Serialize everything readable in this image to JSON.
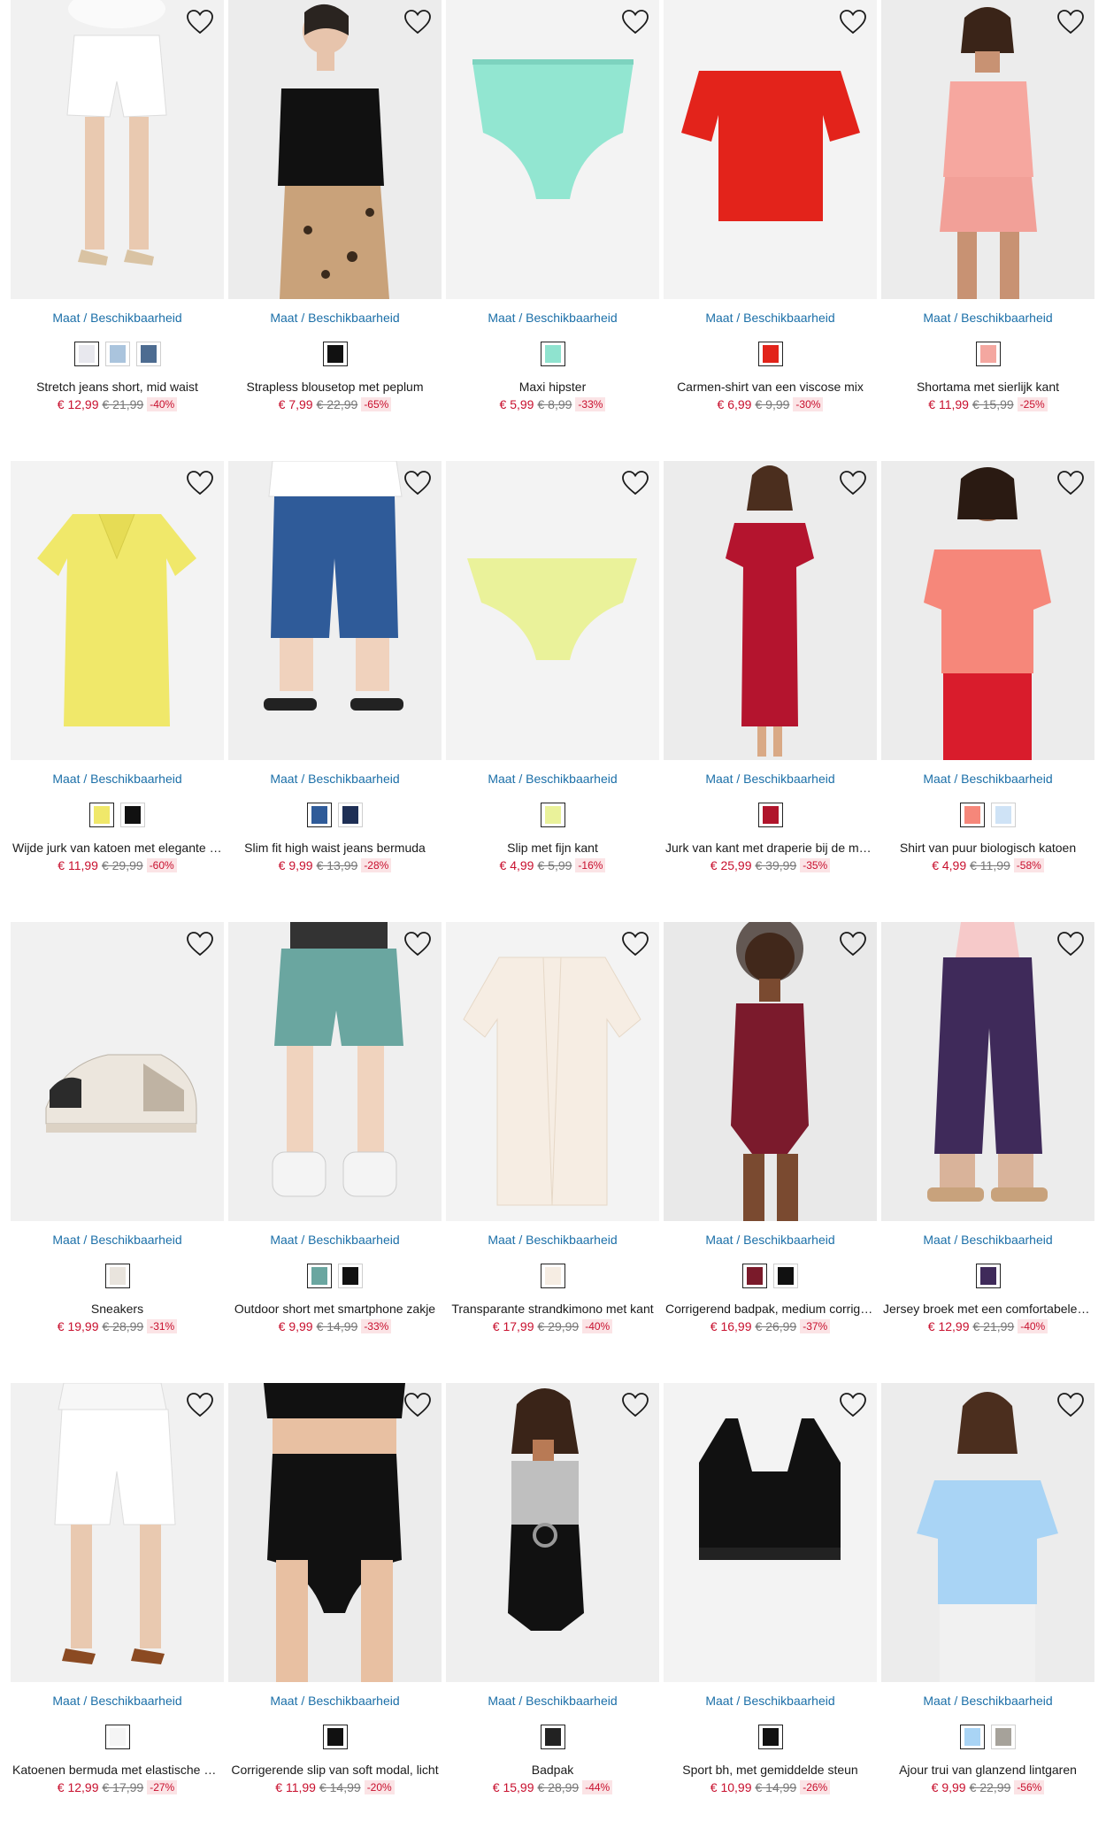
{
  "size_link_label": "Maat / Beschikbaarheid",
  "products": [
    {
      "title": "Stretch jeans short, mid waist",
      "price": "€ 12,99",
      "old_price": "€ 21,99",
      "discount": "-40%",
      "image": "white-denim-shorts",
      "bg": "#f1f1f1",
      "swatches": [
        "#e8e8ee",
        "#aac4dd",
        "#4d6c91"
      ]
    },
    {
      "title": "Strapless blousetop met peplum",
      "price": "€ 7,99",
      "old_price": "€ 22,99",
      "discount": "-65%",
      "image": "black-strapless-top",
      "bg": "#ececec",
      "swatches": [
        "#111111"
      ]
    },
    {
      "title": "Maxi hipster",
      "price": "€ 5,99",
      "old_price": "€ 8,99",
      "discount": "-33%",
      "image": "mint-briefs",
      "bg": "#f3f3f3",
      "swatches": [
        "#8fe3cf"
      ]
    },
    {
      "title": "Carmen-shirt van een viscose mix",
      "price": "€ 6,99",
      "old_price": "€ 9,99",
      "discount": "-30%",
      "image": "red-offshoulder-shirt",
      "bg": "#f3f3f3",
      "swatches": [
        "#e2231a"
      ]
    },
    {
      "title": "Shortama met sierlijk kant",
      "price": "€ 11,99",
      "old_price": "€ 15,99",
      "discount": "-25%",
      "image": "pink-shortama",
      "bg": "#ececec",
      "swatches": [
        "#f4a7a0"
      ]
    },
    {
      "title": "Wijde jurk van katoen met elegante kraag",
      "price": "€ 11,99",
      "old_price": "€ 29,99",
      "discount": "-60%",
      "image": "yellow-dress",
      "bg": "#f3f3f3",
      "swatches": [
        "#f0e86a",
        "#111111"
      ]
    },
    {
      "title": "Slim fit high waist jeans bermuda",
      "price": "€ 9,99",
      "old_price": "€ 13,99",
      "discount": "-28%",
      "image": "denim-bermuda",
      "bg": "#efefef",
      "swatches": [
        "#2f5b99",
        "#1e2f55"
      ]
    },
    {
      "title": "Slip met fijn kant",
      "price": "€ 4,99",
      "old_price": "€ 5,99",
      "discount": "-16%",
      "image": "lime-slip",
      "bg": "#f3f3f3",
      "swatches": [
        "#eaf29a"
      ]
    },
    {
      "title": "Jurk van kant met draperie bij de mouwen",
      "price": "€ 25,99",
      "old_price": "€ 39,99",
      "discount": "-35%",
      "image": "red-lace-dress",
      "bg": "#ececec",
      "swatches": [
        "#b0142b"
      ]
    },
    {
      "title": "Shirt van puur biologisch katoen",
      "price": "€ 4,99",
      "old_price": "€ 11,99",
      "discount": "-58%",
      "image": "coral-shirt",
      "bg": "#ececec",
      "swatches": [
        "#f6877a",
        "#cfe3f6"
      ]
    },
    {
      "title": "Sneakers",
      "price": "€ 19,99",
      "old_price": "€ 28,99",
      "discount": "-31%",
      "image": "sneaker",
      "bg": "#f1f1f1",
      "swatches": [
        "#e9e4dd"
      ]
    },
    {
      "title": "Outdoor short met smartphone zakje",
      "price": "€ 9,99",
      "old_price": "€ 14,99",
      "discount": "-33%",
      "image": "teal-shorts",
      "bg": "#efefef",
      "swatches": [
        "#6aa6a0",
        "#111111"
      ]
    },
    {
      "title": "Transparante strandkimono met kant",
      "price": "€ 17,99",
      "old_price": "€ 29,99",
      "discount": "-40%",
      "image": "kimono",
      "bg": "#f3f3f3",
      "swatches": [
        "#f6ede3"
      ]
    },
    {
      "title": "Corrigerend badpak, medium corrigerend",
      "price": "€ 16,99",
      "old_price": "€ 26,99",
      "discount": "-37%",
      "image": "burgundy-swimsuit",
      "bg": "#e9e9e9",
      "swatches": [
        "#7a1a2a",
        "#111111"
      ]
    },
    {
      "title": "Jersey broek met een comfortabele band",
      "price": "€ 12,99",
      "old_price": "€ 21,99",
      "discount": "-40%",
      "image": "purple-trousers",
      "bg": "#ececec",
      "swatches": [
        "#3f2a5a"
      ]
    },
    {
      "title": "Katoenen bermuda met elastische band",
      "price": "€ 12,99",
      "old_price": "€ 17,99",
      "discount": "-27%",
      "image": "white-bermuda",
      "bg": "#f1f1f1",
      "swatches": [
        "#f5f5f5"
      ]
    },
    {
      "title": "Corrigerende slip van soft modal, licht",
      "price": "€ 11,99",
      "old_price": "€ 14,99",
      "discount": "-20%",
      "image": "black-shapewear",
      "bg": "#ececec",
      "swatches": [
        "#111111"
      ]
    },
    {
      "title": "Badpak",
      "price": "€ 15,99",
      "old_price": "€ 28,99",
      "discount": "-44%",
      "image": "silver-swimsuit",
      "bg": "#efefef",
      "swatches": [
        "#222222"
      ]
    },
    {
      "title": "Sport bh, met gemiddelde steun",
      "price": "€ 10,99",
      "old_price": "€ 14,99",
      "discount": "-26%",
      "image": "sports-bra",
      "bg": "#f3f3f3",
      "swatches": [
        "#111111"
      ]
    },
    {
      "title": "Ajour trui van glanzend lintgaren",
      "price": "€ 9,99",
      "old_price": "€ 22,99",
      "discount": "-56%",
      "image": "blue-knit-top",
      "bg": "#ececec",
      "swatches": [
        "#a9d4f5",
        "#a6a29a"
      ]
    }
  ]
}
